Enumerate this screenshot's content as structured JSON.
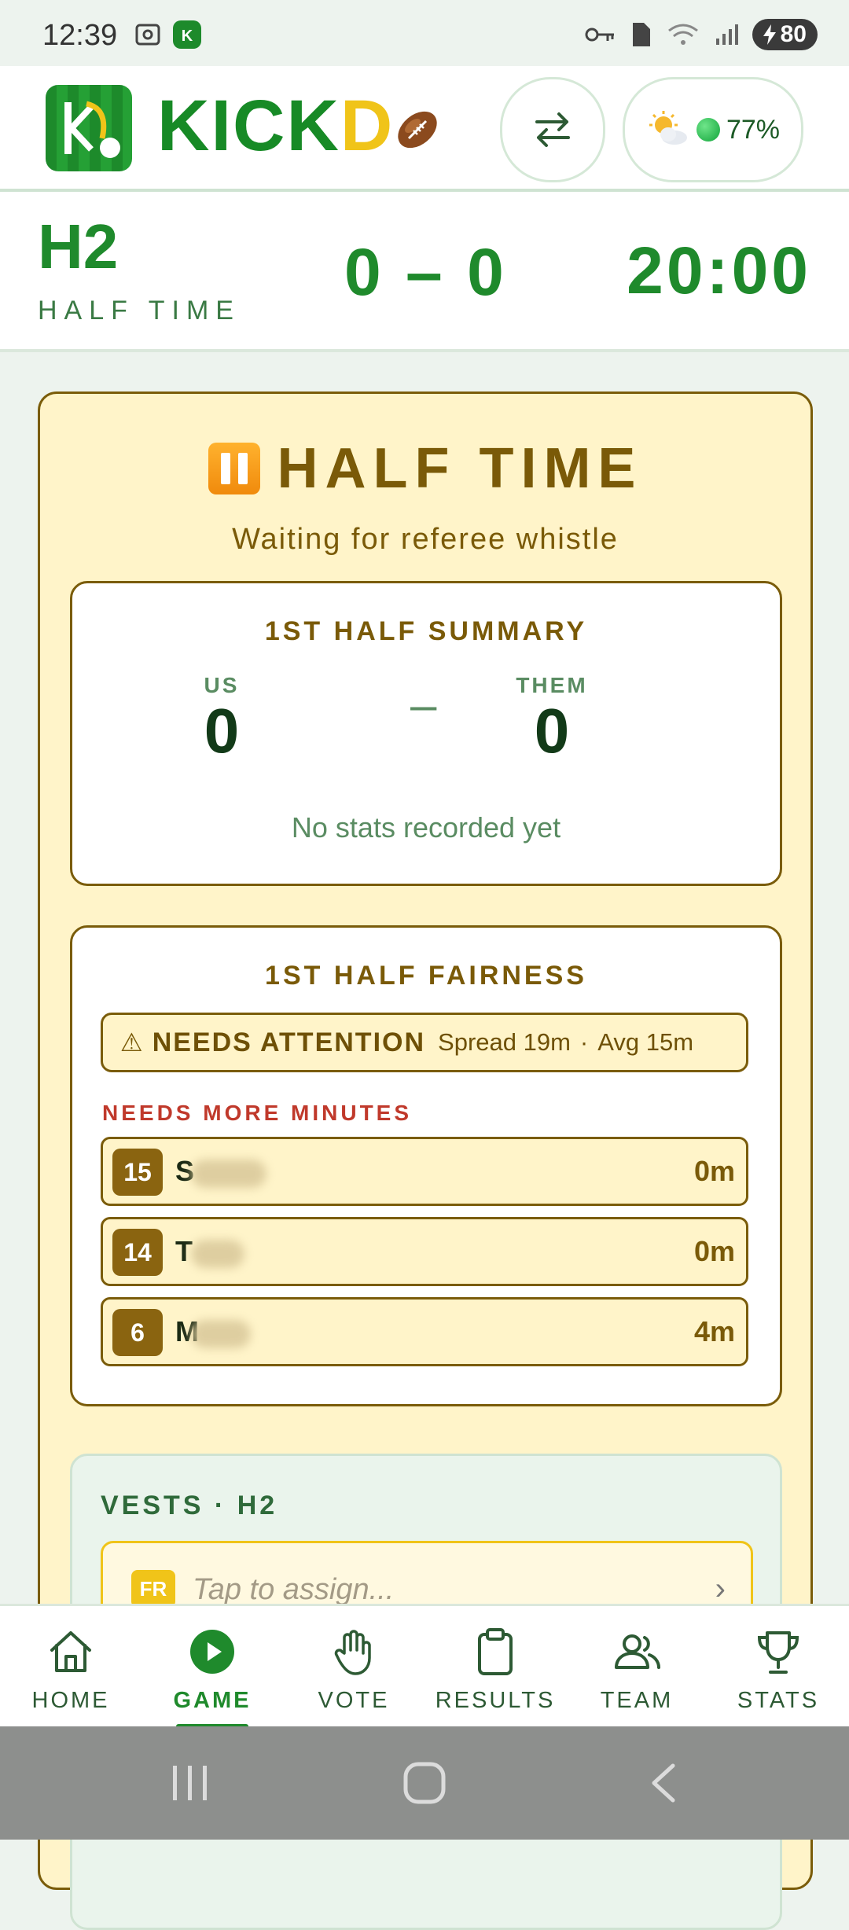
{
  "status_bar": {
    "time": "12:39",
    "battery": "80"
  },
  "header": {
    "brand_main": "KICK",
    "brand_accent": "D",
    "weather_percent": "77%",
    "icons": [
      "logo-icon",
      "football-icon",
      "swap-icon",
      "weather-icon",
      "status-dot-icon"
    ]
  },
  "scoreboard": {
    "period": "H2",
    "period_label": "HALF TIME",
    "score": "0 – 0",
    "clock": "20:00"
  },
  "halftime": {
    "title": "HALF TIME",
    "subtitle": "Waiting for referee whistle",
    "summary": {
      "heading": "1ST HALF SUMMARY",
      "us_label": "US",
      "them_label": "THEM",
      "us_score": "0",
      "them_score": "0",
      "separator": "–",
      "empty_text": "No stats recorded yet"
    },
    "fairness": {
      "heading": "1ST HALF FAIRNESS",
      "status": "NEEDS ATTENTION",
      "spread": "Spread 19m",
      "dot": "·",
      "avg": "Avg 15m",
      "needs_label": "NEEDS MORE MINUTES",
      "players": [
        {
          "number": "15",
          "initial": "S",
          "minutes": "0m"
        },
        {
          "number": "14",
          "initial": "T",
          "minutes": "0m"
        },
        {
          "number": "6",
          "initial": "M",
          "minutes": "4m"
        }
      ]
    },
    "vests": {
      "heading": "VESTS · H2",
      "badge": "FR",
      "placeholder": "Tap to assign...",
      "chevron": "›"
    }
  },
  "nav": {
    "items": [
      {
        "label": "HOME",
        "icon": "home-icon"
      },
      {
        "label": "GAME",
        "icon": "play-icon"
      },
      {
        "label": "VOTE",
        "icon": "hand-icon"
      },
      {
        "label": "RESULTS",
        "icon": "clipboard-icon"
      },
      {
        "label": "TEAM",
        "icon": "team-icon"
      },
      {
        "label": "STATS",
        "icon": "trophy-icon"
      }
    ],
    "active": "GAME"
  },
  "colors": {
    "brand_green": "#1f8a2c",
    "accent_yellow": "#f0c419",
    "halftime_bg": "#fff4c9",
    "halftime_text": "#7a5a08",
    "alert_red": "#c0392b"
  }
}
